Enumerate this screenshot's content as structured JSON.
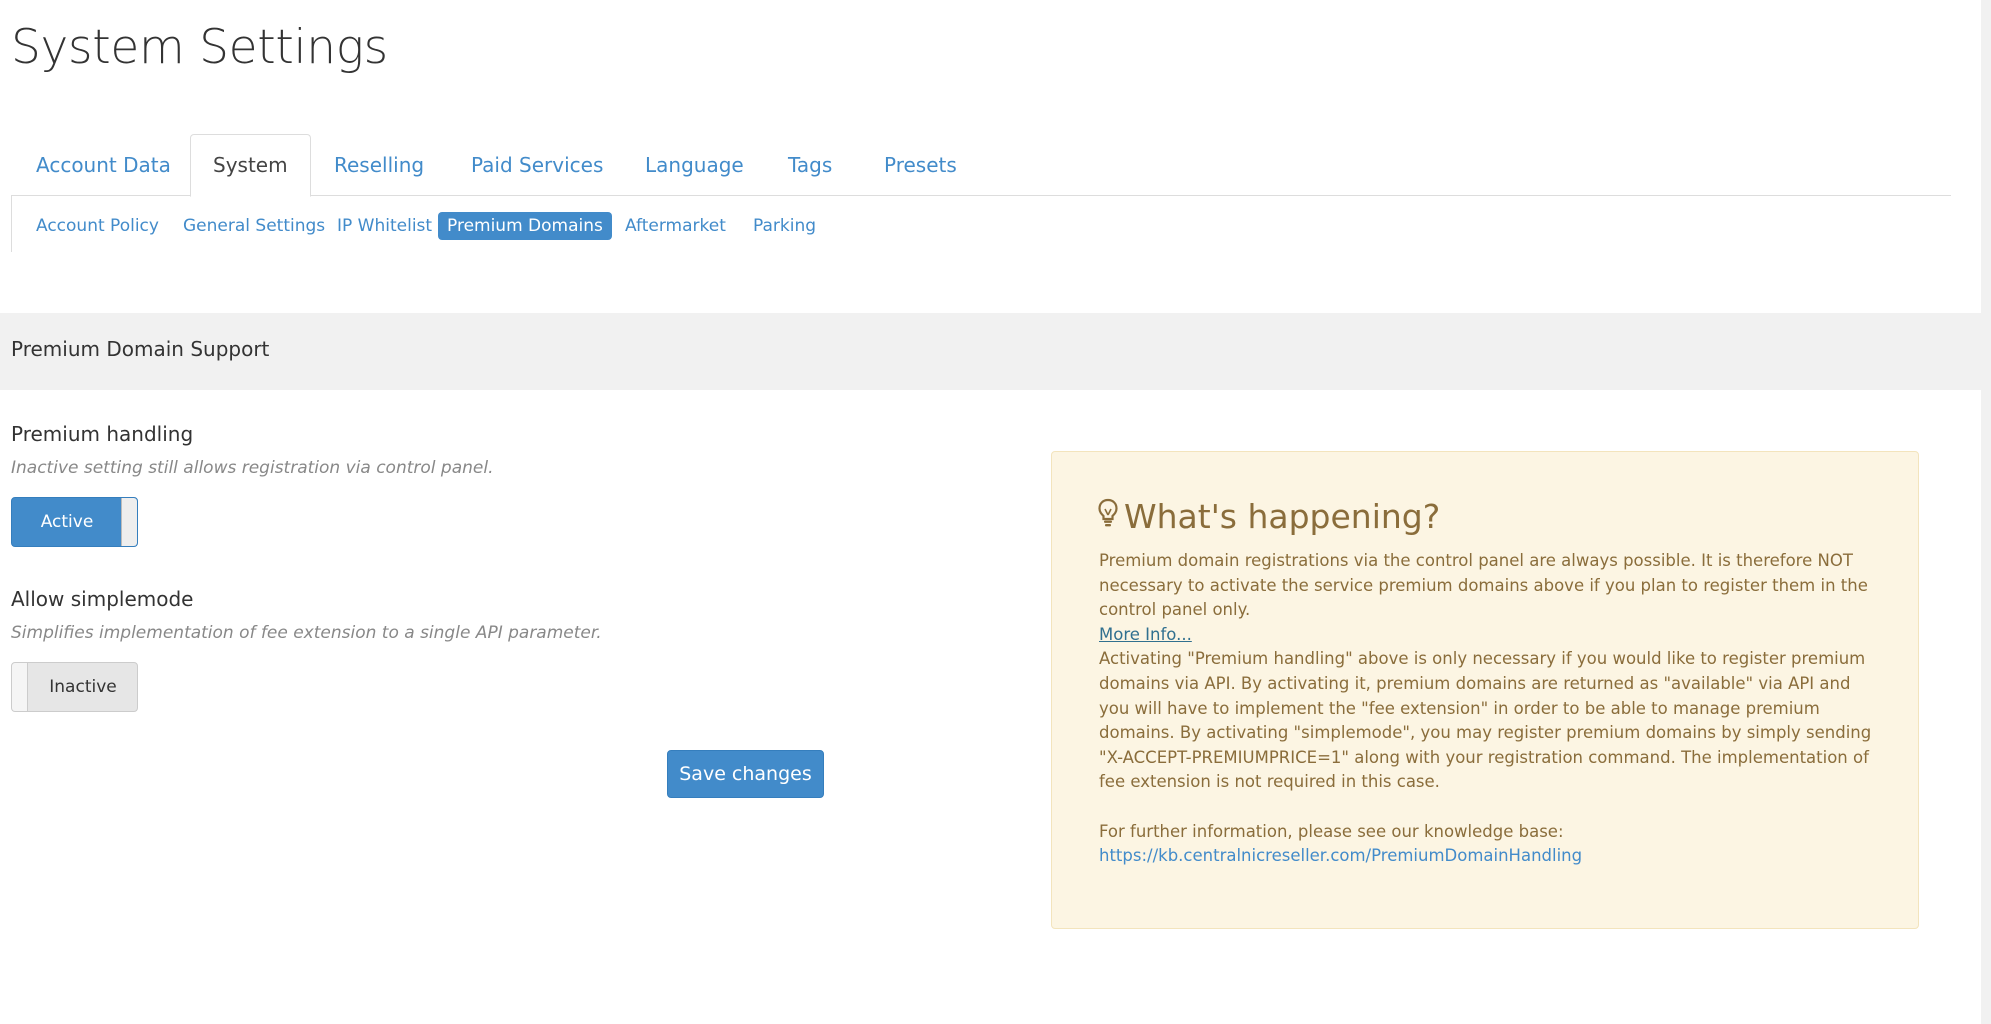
{
  "page": {
    "title": "System Settings"
  },
  "main_tabs": [
    {
      "label": "Account Data",
      "active": false
    },
    {
      "label": "System",
      "active": true
    },
    {
      "label": "Reselling",
      "active": false
    },
    {
      "label": "Paid Services",
      "active": false
    },
    {
      "label": "Language",
      "active": false
    },
    {
      "label": "Tags",
      "active": false
    },
    {
      "label": "Presets",
      "active": false
    }
  ],
  "sub_tabs": [
    {
      "label": "Account Policy",
      "active": false
    },
    {
      "label": "General Settings",
      "active": false
    },
    {
      "label": "IP Whitelist",
      "active": false
    },
    {
      "label": "Premium Domains",
      "active": true
    },
    {
      "label": "Aftermarket",
      "active": false
    },
    {
      "label": "Parking",
      "active": false
    }
  ],
  "section": {
    "title": "Premium Domain Support"
  },
  "form": {
    "premium_handling": {
      "label": "Premium handling",
      "help": "Inactive setting still allows registration via control panel.",
      "state": "Active",
      "enabled": true
    },
    "simplemode": {
      "label": "Allow simplemode",
      "help": "Simplifies implementation of fee extension to a single API parameter.",
      "state": "Inactive",
      "enabled": false
    },
    "save_label": "Save changes"
  },
  "info": {
    "icon": "lightbulb-icon",
    "heading": "What's happening?",
    "paragraph1": "Premium domain registrations via the control panel are always possible. It is therefore NOT necessary to activate the service premium domains above if you plan to register them in the control panel only.",
    "more_link": "More Info...",
    "paragraph2": "Activating \"Premium handling\" above is only necessary if you would like to register premium domains via API. By activating it, premium domains are returned as \"available\" via API and you will have to implement the \"fee extension\" in order to be able to manage premium domains. By activating \"simplemode\", you may register premium domains by simply sending \"X-ACCEPT-PREMIUMPRICE=1\" along with your registration command. The implementation of fee extension is not required in this case.",
    "kb_intro": "For further information, please see our knowledge base:",
    "kb_link": "https://kb.centralnicreseller.com/PremiumDomainHandling"
  },
  "colors": {
    "accent": "#428bca",
    "info_bg": "#fcf5e3",
    "info_text": "#8a6d3b",
    "band_bg": "#f1f1f1"
  }
}
